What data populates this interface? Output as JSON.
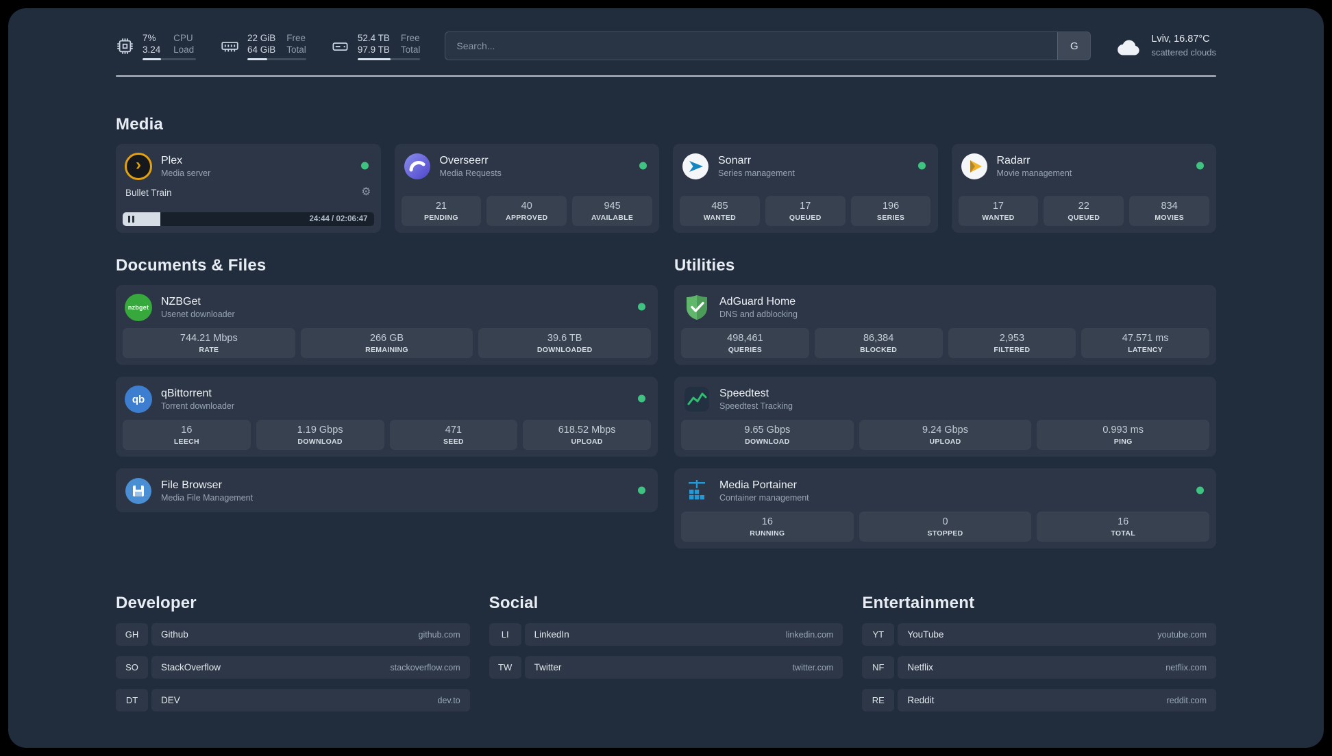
{
  "topbar": {
    "resources": [
      {
        "id": "cpu",
        "icon": "cpu-icon",
        "values": [
          "7%",
          "3.24"
        ],
        "labels": [
          "CPU",
          "Load"
        ],
        "percent": 35
      },
      {
        "id": "memory",
        "icon": "memory-icon",
        "values": [
          "22 GiB",
          "64 GiB"
        ],
        "labels": [
          "Free",
          "Total"
        ],
        "percent": 34
      },
      {
        "id": "disk",
        "icon": "disk-icon",
        "values": [
          "52.4 TB",
          "97.9 TB"
        ],
        "labels": [
          "Free",
          "Total"
        ],
        "percent": 53
      }
    ],
    "search": {
      "placeholder": "Search...",
      "provider_button": "G"
    },
    "weather": {
      "location": "Lviv, 16.87°C",
      "condition": "scattered clouds"
    }
  },
  "sections": {
    "media": {
      "title": "Media",
      "services": [
        {
          "id": "plex",
          "name": "Plex",
          "desc": "Media server",
          "online": true,
          "player": {
            "track": "Bullet Train",
            "time": "24:44 / 02:06:47",
            "progress": 15
          }
        },
        {
          "id": "overseerr",
          "name": "Overseerr",
          "desc": "Media Requests",
          "online": true,
          "stats": [
            {
              "value": "21",
              "label": "PENDING"
            },
            {
              "value": "40",
              "label": "APPROVED"
            },
            {
              "value": "945",
              "label": "AVAILABLE"
            }
          ]
        },
        {
          "id": "sonarr",
          "name": "Sonarr",
          "desc": "Series management",
          "online": true,
          "stats": [
            {
              "value": "485",
              "label": "WANTED"
            },
            {
              "value": "17",
              "label": "QUEUED"
            },
            {
              "value": "196",
              "label": "SERIES"
            }
          ]
        },
        {
          "id": "radarr",
          "name": "Radarr",
          "desc": "Movie management",
          "online": true,
          "stats": [
            {
              "value": "17",
              "label": "WANTED"
            },
            {
              "value": "22",
              "label": "QUEUED"
            },
            {
              "value": "834",
              "label": "MOVIES"
            }
          ]
        }
      ]
    },
    "documents": {
      "title": "Documents & Files",
      "services": [
        {
          "id": "nzbget",
          "name": "NZBGet",
          "desc": "Usenet downloader",
          "online": true,
          "stats": [
            {
              "value": "744.21 Mbps",
              "label": "RATE"
            },
            {
              "value": "266 GB",
              "label": "REMAINING"
            },
            {
              "value": "39.6 TB",
              "label": "DOWNLOADED"
            }
          ]
        },
        {
          "id": "qbittorrent",
          "name": "qBittorrent",
          "desc": "Torrent downloader",
          "online": true,
          "stats": [
            {
              "value": "16",
              "label": "LEECH"
            },
            {
              "value": "1.19 Gbps",
              "label": "DOWNLOAD"
            },
            {
              "value": "471",
              "label": "SEED"
            },
            {
              "value": "618.52 Mbps",
              "label": "UPLOAD"
            }
          ]
        },
        {
          "id": "filebrowser",
          "name": "File Browser",
          "desc": "Media File Management",
          "online": true,
          "stats": []
        }
      ]
    },
    "utilities": {
      "title": "Utilities",
      "services": [
        {
          "id": "adguard",
          "name": "AdGuard Home",
          "desc": "DNS and adblocking",
          "online": false,
          "stats": [
            {
              "value": "498,461",
              "label": "QUERIES"
            },
            {
              "value": "86,384",
              "label": "BLOCKED"
            },
            {
              "value": "2,953",
              "label": "FILTERED"
            },
            {
              "value": "47.571 ms",
              "label": "LATENCY"
            }
          ]
        },
        {
          "id": "speedtest",
          "name": "Speedtest",
          "desc": "Speedtest Tracking",
          "online": false,
          "stats": [
            {
              "value": "9.65 Gbps",
              "label": "DOWNLOAD"
            },
            {
              "value": "9.24 Gbps",
              "label": "UPLOAD"
            },
            {
              "value": "0.993 ms",
              "label": "PING"
            }
          ]
        },
        {
          "id": "portainer",
          "name": "Media Portainer",
          "desc": "Container management",
          "online": true,
          "stats": [
            {
              "value": "16",
              "label": "RUNNING"
            },
            {
              "value": "0",
              "label": "STOPPED"
            },
            {
              "value": "16",
              "label": "TOTAL"
            }
          ]
        }
      ]
    }
  },
  "bookmarks": [
    {
      "title": "Developer",
      "items": [
        {
          "abbr": "GH",
          "name": "Github",
          "url": "github.com"
        },
        {
          "abbr": "SO",
          "name": "StackOverflow",
          "url": "stackoverflow.com"
        },
        {
          "abbr": "DT",
          "name": "DEV",
          "url": "dev.to"
        }
      ]
    },
    {
      "title": "Social",
      "items": [
        {
          "abbr": "LI",
          "name": "LinkedIn",
          "url": "linkedin.com"
        },
        {
          "abbr": "TW",
          "name": "Twitter",
          "url": "twitter.com"
        }
      ]
    },
    {
      "title": "Entertainment",
      "items": [
        {
          "abbr": "YT",
          "name": "YouTube",
          "url": "youtube.com"
        },
        {
          "abbr": "NF",
          "name": "Netflix",
          "url": "netflix.com"
        },
        {
          "abbr": "RE",
          "name": "Reddit",
          "url": "reddit.com"
        }
      ]
    }
  ],
  "colors": {
    "status_online": "#3fc380",
    "plex_accent": "#e5a00d"
  }
}
